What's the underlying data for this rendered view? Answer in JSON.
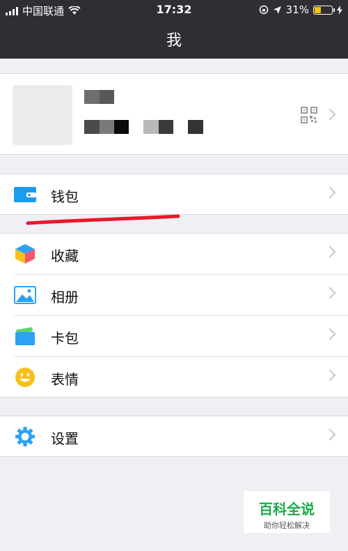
{
  "status_bar": {
    "carrier": "中国联通",
    "time": "17:32",
    "battery": "31%",
    "battery_level": 0.31
  },
  "nav": {
    "title": "我"
  },
  "menu": {
    "wallet": "钱包",
    "favorites": "收藏",
    "album": "相册",
    "card_pack": "卡包",
    "stickers": "表情",
    "settings": "设置"
  },
  "watermark": {
    "title": "百科全说",
    "subtitle": "助你轻松解决"
  },
  "colors": {
    "topbar": "#2e2e33",
    "wallet_blue": "#1a9cf0",
    "annotation_red": "#e8192c",
    "watermark_green": "#1aaa4a"
  }
}
